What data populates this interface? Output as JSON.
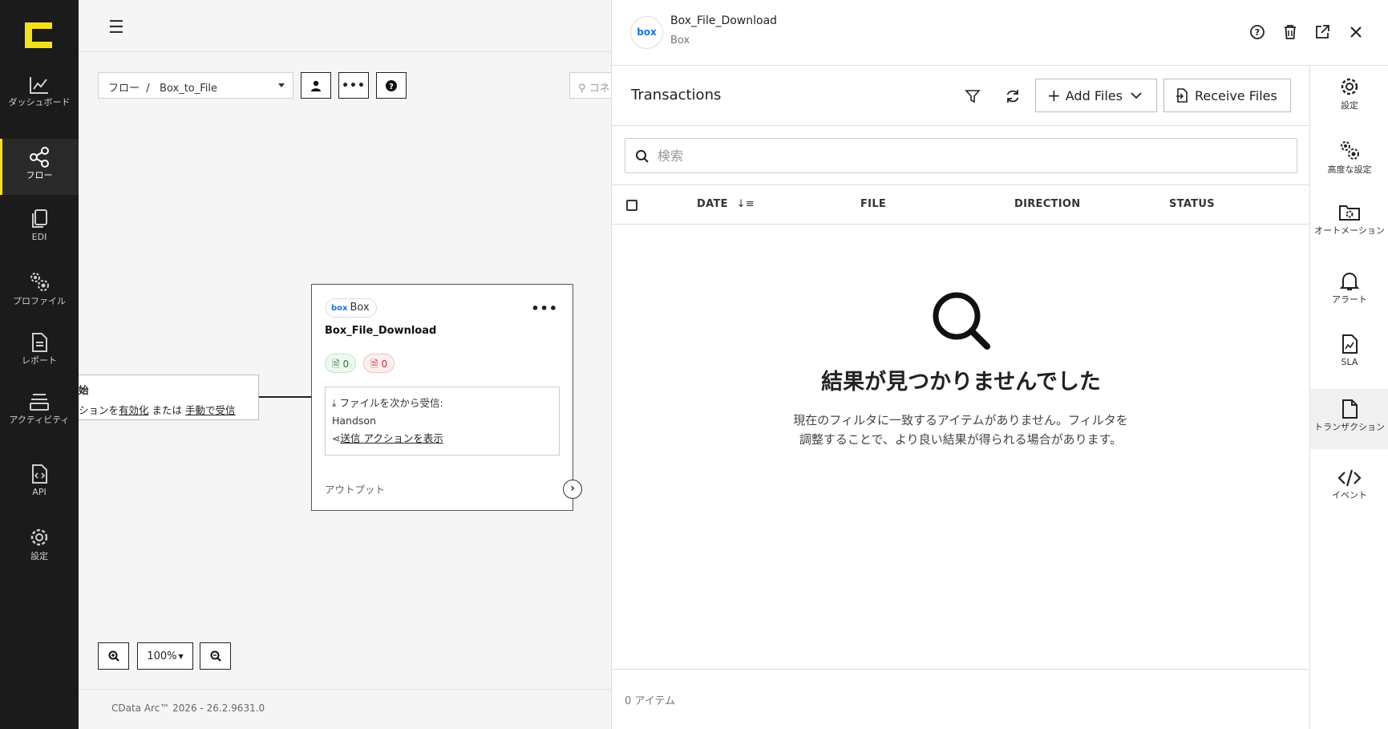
{
  "nav": {
    "items": [
      {
        "label": "ダッシュボード",
        "icon": "chart-line-icon"
      },
      {
        "label": "フロー",
        "icon": "share-nodes-icon"
      },
      {
        "label": "EDI",
        "icon": "copy-icon"
      },
      {
        "label": "プロファイル",
        "icon": "gears-icon"
      },
      {
        "label": "レポート",
        "icon": "document-icon"
      },
      {
        "label": "アクティビティ",
        "icon": "layers-icon"
      },
      {
        "label": "API",
        "icon": "file-code-icon"
      },
      {
        "label": "設定",
        "icon": "gear-icon"
      }
    ]
  },
  "canvas": {
    "breadcrumb": "フロー  /   Box_to_File",
    "search_placeholder": "コネ",
    "start_node": {
      "title": "始",
      "prefix": "ションを",
      "enable_link": "有効化",
      "or": "または",
      "manual_link": "手動で受信"
    },
    "node": {
      "badge_logo": "box",
      "badge_label": "Box",
      "name": "Box_File_Download",
      "success_count": "0",
      "error_count": "0",
      "receive_label": "ファイルを次から受信:",
      "receive_source": "Handson",
      "send_link": "送信 アクションを表示",
      "output_label": "アウトプット"
    },
    "zoom_level": "100%",
    "version": "CData Arc™ 2026 - 26.2.9631.0"
  },
  "panel": {
    "logo": "box",
    "title": "Box_File_Download",
    "subtitle": "Box",
    "transactions_title": "Transactions",
    "add_files_label": "Add Files",
    "receive_files_label": "Receive Files",
    "search_placeholder": "検索",
    "columns": [
      "DATE",
      "FILE",
      "DIRECTION",
      "STATUS"
    ],
    "empty_title": "結果が見つかりませんでした",
    "empty_desc": "現在のフィルタに一致するアイテムがありません。フィルタを調整することで、より良い結果が得られる場合があります。",
    "item_count": "0 アイテム",
    "side_items": [
      {
        "label": "設定",
        "icon": "gear-icon"
      },
      {
        "label": "高度な設定",
        "icon": "gears-icon"
      },
      {
        "label": "オートメーション",
        "icon": "folder-gear-icon"
      },
      {
        "label": "アラート",
        "icon": "bell-icon"
      },
      {
        "label": "SLA",
        "icon": "file-chart-icon"
      },
      {
        "label": "トランザクション",
        "icon": "file-icon"
      },
      {
        "label": "イベント",
        "icon": "code-icon"
      }
    ]
  }
}
